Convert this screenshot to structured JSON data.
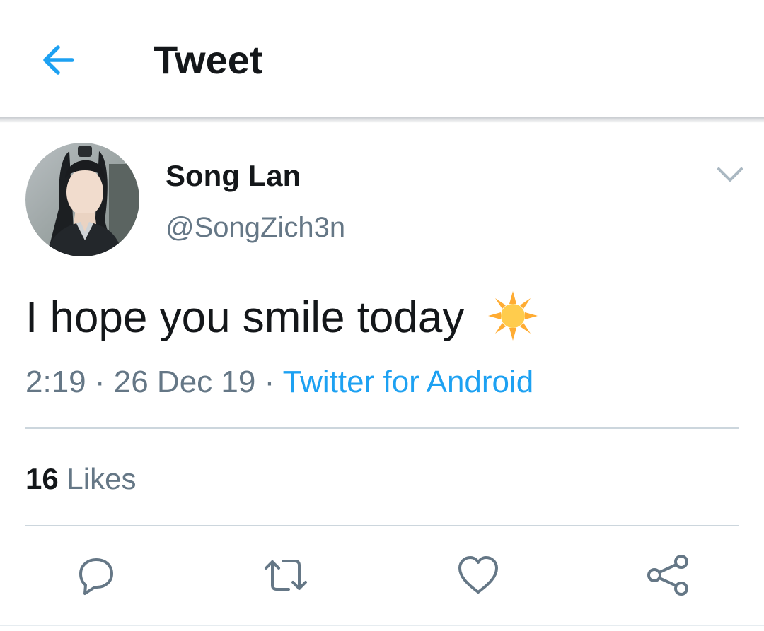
{
  "header": {
    "title": "Tweet",
    "back_icon": "arrow-left-icon",
    "accent_color": "#1da1f2"
  },
  "tweet": {
    "author": {
      "name": "Song Lan",
      "handle": "@SongZich3n",
      "avatar_icon": "profile-photo"
    },
    "text": "I hope you smile today",
    "emoji": "sun-icon",
    "time": "2:19",
    "date": "26 Dec 19",
    "separator": "·",
    "source": "Twitter for Android",
    "likes": {
      "count": "16",
      "label": "Likes"
    }
  },
  "actions": [
    {
      "icon": "reply-icon"
    },
    {
      "icon": "retweet-icon"
    },
    {
      "icon": "heart-icon"
    },
    {
      "icon": "share-icon"
    }
  ],
  "colors": {
    "text_primary": "#14171a",
    "text_secondary": "#657786",
    "link": "#1da1f2",
    "divider": "#ccd6dd"
  }
}
